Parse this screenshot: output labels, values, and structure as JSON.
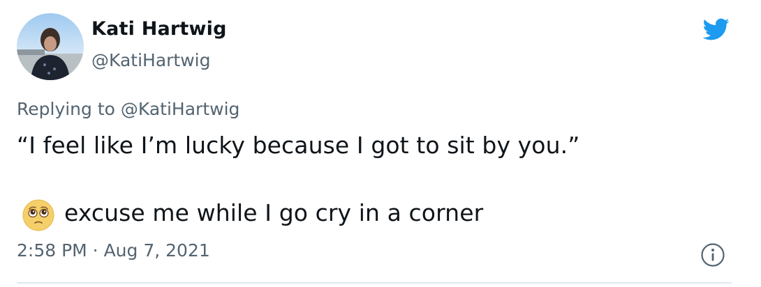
{
  "author": {
    "display_name": "Kati Hartwig",
    "handle": "@KatiHartwig"
  },
  "icons": {
    "brand": "twitter-bird-icon",
    "brand_color": "#1d9bf0",
    "info": "info-icon",
    "emoji": "pleading-face-emoji"
  },
  "reply": {
    "prefix": "Replying to",
    "mention": "@KatiHartwig"
  },
  "tweet": {
    "line1": "“I feel like I’m lucky because I got to sit by you.”",
    "line2": "excuse me while I go cry in a corner"
  },
  "meta": {
    "timestamp": "2:58 PM · Aug 7, 2021"
  },
  "colors": {
    "text_primary": "#0f1419",
    "text_secondary": "#536471"
  }
}
